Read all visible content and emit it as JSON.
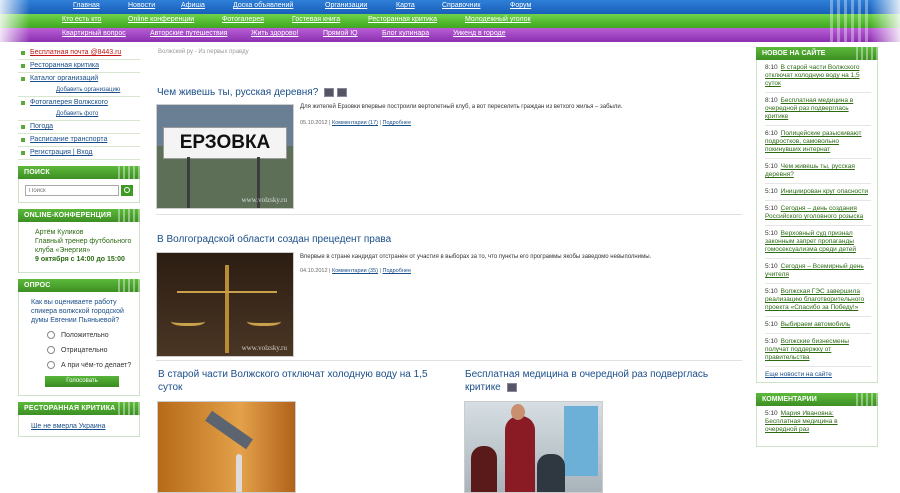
{
  "nav": {
    "row1": [
      "Главная",
      "Новости",
      "Афиша",
      "Доска объявлений",
      "Организации",
      "Карта",
      "Справочник",
      "Форум"
    ],
    "row2": [
      "Кто есть кто",
      "Online конференции",
      "Фотогалерея",
      "Гостевая книга",
      "Ресторанная критика",
      "Молодежный уголок"
    ],
    "row3": [
      "Квартирный вопрос",
      "Авторские путешествия",
      "Жить здорово!",
      "Прямой IQ",
      "Блог кулинара",
      "Уикенд в городе"
    ]
  },
  "left": {
    "menu": [
      {
        "label": "Бесплатная почта @8443.ru",
        "red": true
      },
      {
        "label": "Ресторанная критика"
      },
      {
        "label": "Каталог организаций"
      },
      {
        "label": "Добавить организацию",
        "sub": true
      },
      {
        "label": "Фотогалерея Волжского"
      },
      {
        "label": "Добавить фото",
        "sub": true
      },
      {
        "label": "Погода"
      },
      {
        "label": "Расписание транспорта"
      },
      {
        "label": "Регистрация | Вход"
      }
    ],
    "search": {
      "heading": "ПОИСК",
      "placeholder": "Поиск"
    },
    "conference": {
      "heading": "ONLINE-КОНФЕРЕНЦИЯ",
      "name": "Артём Куликов",
      "role": "Главный тренер футбольного клуба «Энергия»",
      "date": "9 октября с 14:00 до 15:00"
    },
    "poll": {
      "heading": "ОПРОС",
      "question": "Как вы оцениваете работу спикера волжской городской думы Евгении Пьяныевой?",
      "options": [
        "Положительно",
        "Отрицательно",
        "А при чём-то делает?"
      ],
      "vote_label": "Голосовать"
    },
    "restaurant": {
      "heading": "РЕСТОРАННАЯ КРИТИКА",
      "link": "Ше не вмерла Украина"
    }
  },
  "main": {
    "breadcrumb": "Волжский ру - Из первых правду",
    "articles": [
      {
        "title": "Чем живешь ты, русская деревня?",
        "text": "Для жителей Ерзовки впервые построили вертолетный клуб, а вот переселить граждан из ветхого жилья – забыли.",
        "date": "05.10.2012",
        "comments": "Комментарии (17)",
        "more": "Подробнее",
        "sign": "ЕРЗОВКА",
        "watermark": "www.volzsky.ru"
      },
      {
        "title": "В Волгоградской области создан прецедент права",
        "text": "Впервые в стране кандидат отстранен от участия в выборах за то, что пункты его программы якобы заведомо невыполнимы.",
        "date": "04.10.2012",
        "comments": "Комментарии (35)",
        "more": "Подробнее",
        "watermark": "www.volzsky.ru"
      },
      {
        "title": "В старой части Волжского отключат холодную воду на 1,5 суток"
      },
      {
        "title": "Бесплатная медицина в очередной раз подверглась критике"
      }
    ]
  },
  "right": {
    "news_heading": "НОВОЕ НА САЙТЕ",
    "news": [
      {
        "time": "8:10",
        "text": "В старой части Волжского отключат холодную воду на 1,5 суток"
      },
      {
        "time": "8:10",
        "text": "Бесплатная медицина в очередной раз подверглась критике"
      },
      {
        "time": "6:10",
        "text": "Полицейские разыскивают подростков, самовольно покинувших интернат"
      },
      {
        "time": "5:10",
        "text": "Чем живешь ты, русская деревня?"
      },
      {
        "time": "5:10",
        "text": "Инициирован круг опасности"
      },
      {
        "time": "5:10",
        "text": "Сегодня – день создания Российского уголовного розыска"
      },
      {
        "time": "5:10",
        "text": "Верховный суд признал законным запрет пропаганды гомосексуализма среди детей"
      },
      {
        "time": "5:10",
        "text": "Сегодня – Всемирный день учителя"
      },
      {
        "time": "5:10",
        "text": "Волжская ГЭС завершила реализацию благотворительного проекта «Спасибо за Победу!»"
      },
      {
        "time": "5:10",
        "text": "Выбираем автомобиль"
      },
      {
        "time": "5:10",
        "text": "Волжские бизнесмены получат поддержку от правительства"
      }
    ],
    "all_news": "Еще новости на сайте",
    "comments_heading": "КОММЕНТАРИИ",
    "comment": {
      "time": "5:10",
      "text": "Мария Ивановна: Бесплатная медицина в очередной раз"
    }
  }
}
